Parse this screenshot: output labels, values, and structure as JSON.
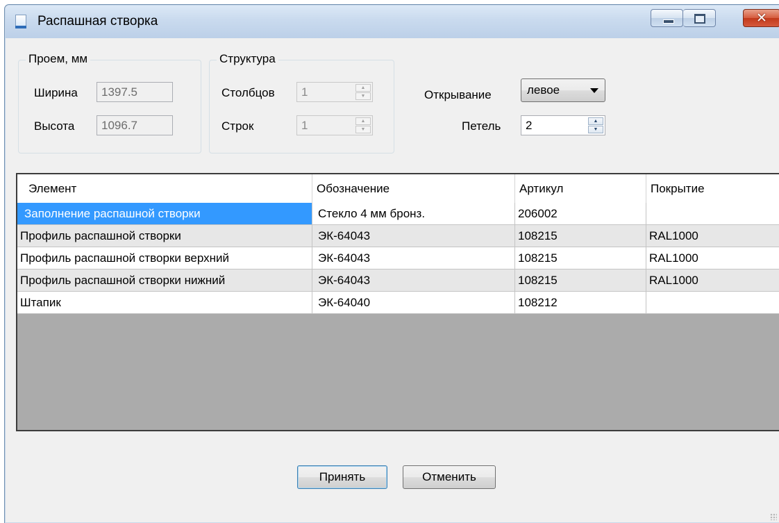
{
  "window": {
    "title": "Распашная створка",
    "min_icon": "minimize-icon",
    "max_icon": "maximize-icon",
    "close_glyph": "✕"
  },
  "opening": {
    "legend": "Проем, мм",
    "width_label": "Ширина",
    "width_value": "1397.5",
    "height_label": "Высота",
    "height_value": "1096.7"
  },
  "structure": {
    "legend": "Структура",
    "columns_label": "Столбцов",
    "columns_value": "1",
    "rows_label": "Строк",
    "rows_value": "1"
  },
  "opening_dir": {
    "label": "Открывание",
    "value": "левое"
  },
  "hinges": {
    "label": "Петель",
    "value": "2"
  },
  "spin": {
    "up": "▲",
    "down": "▼"
  },
  "table": {
    "headers": [
      "Элемент",
      "Обозначение",
      "Артикул",
      "Покрытие"
    ],
    "rows": [
      [
        "Заполнение распашной створки",
        "Стекло 4 мм бронз.",
        "206002",
        ""
      ],
      [
        "Профиль распашной створки",
        "ЭК-64043",
        "108215",
        "RAL1000"
      ],
      [
        "Профиль распашной створки верхний",
        "ЭК-64043",
        "108215",
        "RAL1000"
      ],
      [
        "Профиль распашной створки нижний",
        "ЭК-64043",
        "108215",
        "RAL1000"
      ],
      [
        "Штапик",
        "ЭК-64040",
        "108212",
        ""
      ]
    ]
  },
  "buttons": {
    "accept": "Принять",
    "cancel": "Отменить"
  }
}
